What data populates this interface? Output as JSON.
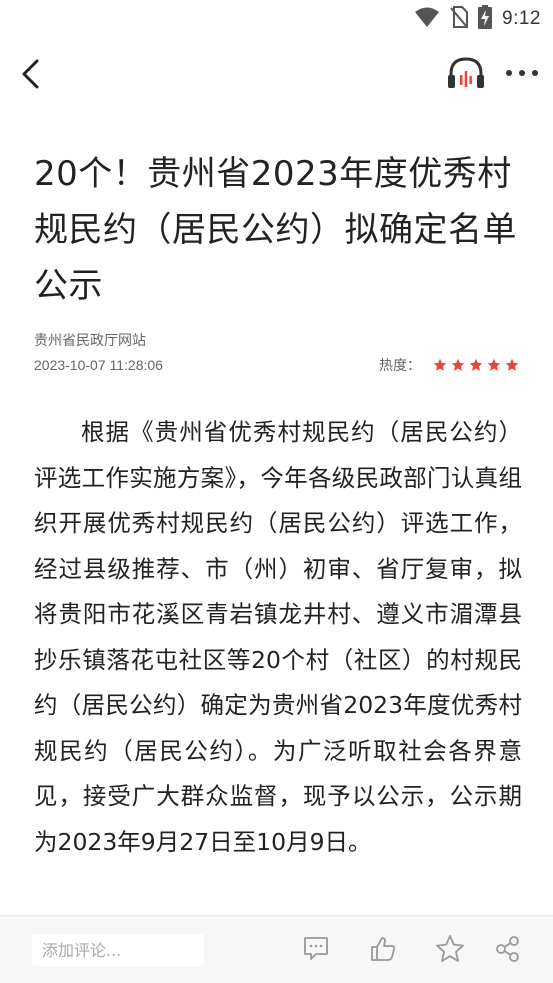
{
  "status_bar": {
    "time": "9:12"
  },
  "article": {
    "title": "20个！贵州省2023年度优秀村规民约（居民公约）拟确定名单公示",
    "source": "贵州省民政厅网站",
    "published": "2023-10-07 11:28:06",
    "heat_label": "热度：",
    "heat_rating": 5,
    "heat_max": 5,
    "body": "根据《贵州省优秀村规民约（居民公约）评选工作实施方案》，今年各级民政部门认真组织开展优秀村规民约（居民公约）评选工作，经过县级推荐、市（州）初审、省厅复审，拟将贵阳市花溪区青岩镇龙井村、遵义市湄潭县抄乐镇落花屯社区等20个村（社区）的村规民约（居民公约）确定为贵州省2023年度优秀村规民约（居民公约）。为广泛听取社会各界意见，接受广大群众监督，现予以公示，公示期为2023年9月27日至10月9日。"
  },
  "bottom_bar": {
    "comment_placeholder": "添加评论..."
  },
  "colors": {
    "star": "#e8453c",
    "icon_gray": "#888888",
    "text": "#222222",
    "meta": "#666666"
  },
  "icons": [
    "wifi-icon",
    "no-sim-icon",
    "battery-charging-icon",
    "back-arrow-icon",
    "headphones-icon",
    "more-icon",
    "comment-icon",
    "thumbs-up-icon",
    "star-icon",
    "share-icon"
  ]
}
